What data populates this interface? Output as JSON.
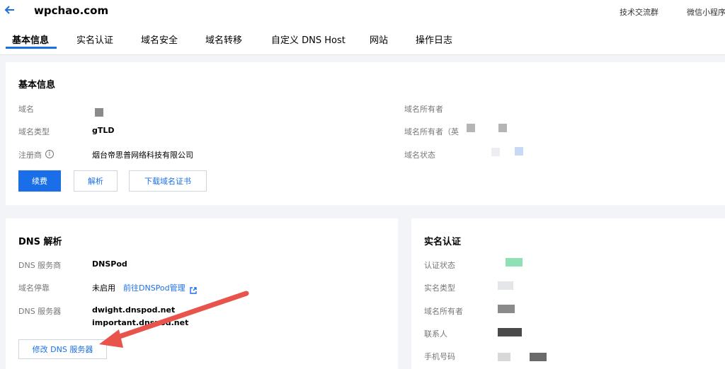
{
  "header": {
    "title": "wpchao.com",
    "links": [
      "技术交流群",
      "微信小程序"
    ]
  },
  "tabs": [
    "基本信息",
    "实名认证",
    "域名安全",
    "域名转移",
    "自定义 DNS Host",
    "网站",
    "操作日志"
  ],
  "basic_info": {
    "title": "基本信息",
    "domain_label": "域名",
    "type_label": "域名类型",
    "type_value": "gTLD",
    "registrar_label": "注册商",
    "registrar_value": "烟台帝思普网络科技有限公司",
    "owner_label": "域名所有者",
    "owner_en_label": "域名所有者（英",
    "status_label": "域名状态",
    "buttons": [
      "续费",
      "解析",
      "下载域名证书"
    ]
  },
  "dns": {
    "title": "DNS 解析",
    "provider_label": "DNS 服务商",
    "provider_value": "DNSPod",
    "parking_label": "域名停靠",
    "parking_value": "未启用",
    "parking_link": "前往DNSPod管理",
    "servers_label": "DNS 服务器",
    "servers": [
      "dwight.dnspod.net",
      "important.dnspod.net"
    ],
    "modify_button": "修改 DNS 服务器"
  },
  "realname": {
    "title": "实名认证",
    "status_label": "认证状态",
    "type_label": "实名类型",
    "owner_label": "域名所有者",
    "contact_label": "联系人",
    "phone_label": "手机号码"
  },
  "colors": {
    "accent": "#1a6fe8",
    "arrow": "#e8534b",
    "verified": "#8fe0b4"
  }
}
